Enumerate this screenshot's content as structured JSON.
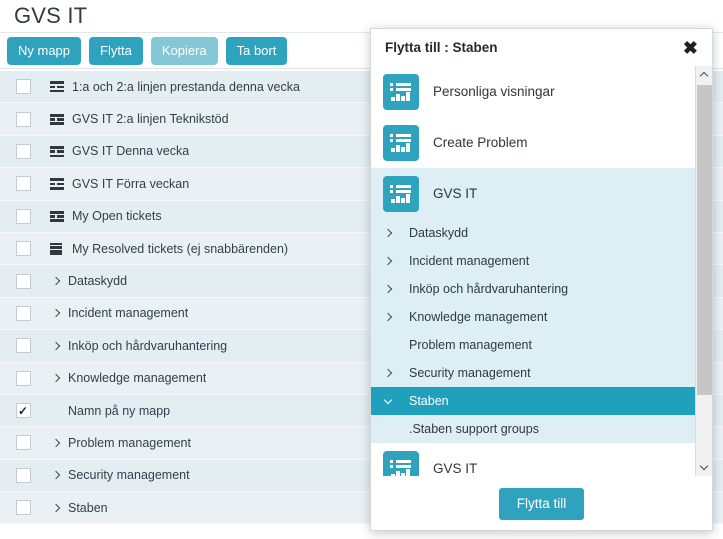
{
  "page": {
    "title": "GVS IT"
  },
  "toolbar": {
    "buttons": [
      {
        "label": "Ny mapp",
        "state": "enabled"
      },
      {
        "label": "Flytta",
        "state": "enabled"
      },
      {
        "label": "Kopiera",
        "state": "disabled"
      },
      {
        "label": "Ta bort",
        "state": "enabled"
      }
    ]
  },
  "list": {
    "rows": [
      {
        "label": "1:a och 2:a linjen prestanda denna vecka",
        "icon": "table-report-icon",
        "checked": false,
        "expandable": false
      },
      {
        "label": "GVS IT 2:a linjen Teknikstöd",
        "icon": "table-report-icon",
        "checked": false,
        "expandable": false
      },
      {
        "label": "GVS IT Denna vecka",
        "icon": "table-report-icon",
        "checked": false,
        "expandable": false
      },
      {
        "label": "GVS IT Förra veckan",
        "icon": "table-report-icon",
        "checked": false,
        "expandable": false
      },
      {
        "label": "My Open tickets",
        "icon": "table-report-icon",
        "checked": false,
        "expandable": false
      },
      {
        "label": "My Resolved tickets (ej snabbärenden)",
        "icon": "list-report-icon",
        "checked": false,
        "expandable": false
      },
      {
        "label": "Dataskydd",
        "icon": "none",
        "checked": false,
        "expandable": true
      },
      {
        "label": "Incident management",
        "icon": "none",
        "checked": false,
        "expandable": true
      },
      {
        "label": "Inköp och hårdvaruhantering",
        "icon": "none",
        "checked": false,
        "expandable": true
      },
      {
        "label": "Knowledge management",
        "icon": "none",
        "checked": false,
        "expandable": true
      },
      {
        "label": "Namn på ny mapp",
        "icon": "none",
        "checked": true,
        "expandable": false
      },
      {
        "label": "Problem management",
        "icon": "none",
        "checked": false,
        "expandable": true
      },
      {
        "label": "Security management",
        "icon": "none",
        "checked": false,
        "expandable": true
      },
      {
        "label": "Staben",
        "icon": "none",
        "checked": false,
        "expandable": true
      }
    ],
    "checkmark_glyph": "✓"
  },
  "modal": {
    "title": "Flytta till : Staben",
    "close_glyph": "✖",
    "folders": [
      {
        "label": "Personliga visningar",
        "selected": false
      },
      {
        "label": "Create Problem",
        "selected": false
      },
      {
        "label": "GVS IT",
        "selected": true
      }
    ],
    "tree": [
      {
        "label": "Dataskydd",
        "expandable": true,
        "active": false,
        "child": false
      },
      {
        "label": "Incident management",
        "expandable": true,
        "active": false,
        "child": false
      },
      {
        "label": "Inköp och hårdvaruhantering",
        "expandable": true,
        "active": false,
        "child": false
      },
      {
        "label": "Knowledge management",
        "expandable": true,
        "active": false,
        "child": false
      },
      {
        "label": "Problem management",
        "expandable": false,
        "active": false,
        "child": false
      },
      {
        "label": "Security management",
        "expandable": true,
        "active": false,
        "child": false
      },
      {
        "label": "Staben",
        "expandable": true,
        "expanded": true,
        "active": true,
        "child": false
      },
      {
        "label": ".Staben support groups",
        "expandable": false,
        "active": false,
        "child": true
      }
    ],
    "clipped_folder": {
      "label": "GVS IT",
      "selected": false
    },
    "confirm_label": "Flytta till"
  },
  "colors": {
    "accent": "#2fa3bd",
    "accent_disabled": "#84c8d7",
    "selected_row": "#1fa0bd",
    "row_bg": "#e4eef2",
    "tree_bg": "#ddeef4"
  }
}
